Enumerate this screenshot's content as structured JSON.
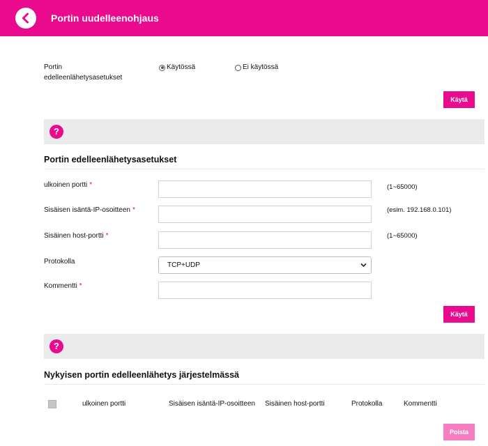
{
  "header": {
    "title": "Portin uudelleenohjaus",
    "back_icon": "chevron-left-icon"
  },
  "enable": {
    "label": "Portin edelleenlähetysasetukset",
    "options": [
      {
        "label": "Käytössä",
        "checked": true
      },
      {
        "label": "Ei käytössä",
        "checked": false
      }
    ],
    "apply_label": "Käytä"
  },
  "help_icon": "?",
  "settings": {
    "title": "Portin edelleenlähetysasetukset",
    "fields": {
      "external_port": {
        "label": "ulkoinen portti",
        "required": "*",
        "value": "",
        "hint": "(1~65000)"
      },
      "internal_ip": {
        "label": "Sisäisen isäntä-IP-osoitteen",
        "required": "*",
        "value": "",
        "hint": "(esim. 192.168.0.101)"
      },
      "internal_port": {
        "label": "Sisäinen host-portti",
        "required": "*",
        "value": "",
        "hint": "(1~65000)"
      },
      "protocol": {
        "label": "Protokolla",
        "selected": "TCP+UDP"
      },
      "comment": {
        "label": "Kommentti",
        "required": "*",
        "value": ""
      }
    },
    "apply_label": "Käytä"
  },
  "current": {
    "title": "Nykyisen portin edelleenlähetys järjestelmässä",
    "columns": [
      "ulkoinen portti",
      "Sisäisen isäntä-IP-osoitteen",
      "Sisäinen host-portti",
      "Protokolla",
      "Kommentti"
    ],
    "delete_label": "Poista"
  },
  "colors": {
    "accent": "#ea0a8e",
    "accent_disabled": "#f47ec0",
    "help_bar": "#ebebeb"
  }
}
